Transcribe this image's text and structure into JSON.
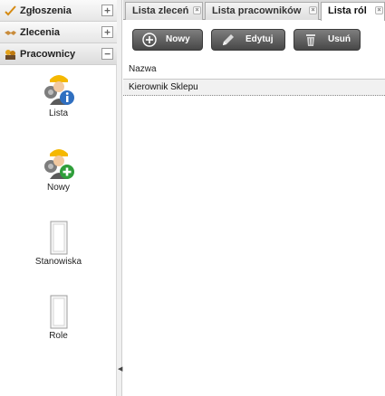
{
  "nav": {
    "sections": [
      {
        "title": "Zgłoszenia",
        "toggle": "+"
      },
      {
        "title": "Zlecenia",
        "toggle": "+"
      },
      {
        "title": "Pracownicy",
        "toggle": "−"
      }
    ],
    "tiles": [
      {
        "label": "Lista",
        "icon": "worker-info-icon"
      },
      {
        "label": "Nowy",
        "icon": "worker-add-icon"
      },
      {
        "label": "Stanowiska",
        "icon": "document-icon"
      },
      {
        "label": "Role",
        "icon": "document-icon"
      }
    ]
  },
  "tabs": [
    {
      "label": "Lista zleceń",
      "active": false
    },
    {
      "label": "Lista pracowników",
      "active": false
    },
    {
      "label": "Lista ról",
      "active": true
    }
  ],
  "toolbar": {
    "new_label": "Nowy",
    "edit_label": "Edytuj",
    "delete_label": "Usuń"
  },
  "grid": {
    "columns": [
      "Nazwa"
    ],
    "rows": [
      [
        "Kierownik Sklepu"
      ]
    ]
  },
  "colors": {
    "button_bg": "#5e5e5e",
    "tab_strip": "#dcdcdc",
    "row_bg": "#f1f1f1"
  }
}
